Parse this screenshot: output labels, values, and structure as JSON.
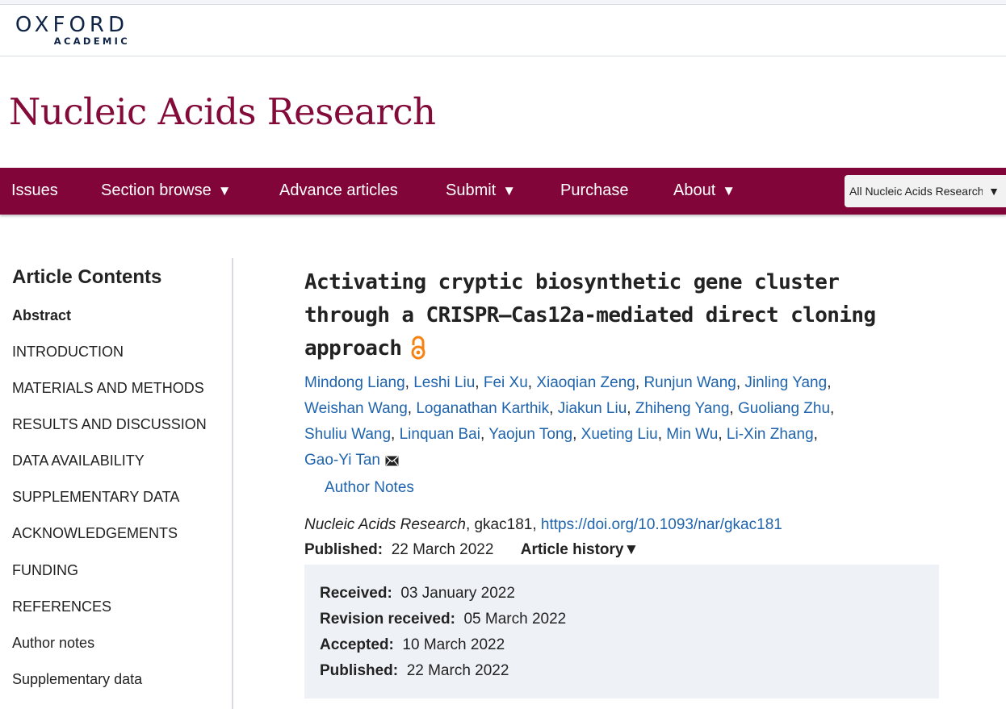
{
  "logo": {
    "line1": "OXFORD",
    "line2": "ACADEMIC"
  },
  "journal": {
    "title": "Nucleic Acids Research"
  },
  "nav": {
    "items": [
      {
        "label": "Issues",
        "dropdown": false
      },
      {
        "label": "Section browse",
        "dropdown": true
      },
      {
        "label": "Advance articles",
        "dropdown": false
      },
      {
        "label": "Submit",
        "dropdown": true
      },
      {
        "label": "Purchase",
        "dropdown": false
      },
      {
        "label": "About",
        "dropdown": true
      }
    ],
    "caret": "▼",
    "search_scope": "All Nucleic Acids Research"
  },
  "sidebar": {
    "heading": "Article Contents",
    "items": [
      {
        "label": "Abstract",
        "active": true
      },
      {
        "label": "INTRODUCTION"
      },
      {
        "label": "MATERIALS AND METHODS"
      },
      {
        "label": "RESULTS AND DISCUSSION"
      },
      {
        "label": "DATA AVAILABILITY"
      },
      {
        "label": "SUPPLEMENTARY DATA"
      },
      {
        "label": "ACKNOWLEDGEMENTS"
      },
      {
        "label": "FUNDING"
      },
      {
        "label": "REFERENCES"
      },
      {
        "label": "Author notes"
      },
      {
        "label": "Supplementary data"
      }
    ]
  },
  "article": {
    "title": "Activating cryptic biosynthetic gene cluster through a CRISPR–Cas12a-mediated direct cloning approach",
    "open_access_icon": "open-access-icon",
    "authors": [
      "Mindong Liang",
      "Leshi Liu",
      "Fei Xu",
      "Xiaoqian Zeng",
      "Runjun Wang",
      "Jinling Yang",
      "Weishan Wang",
      "Loganathan Karthik",
      "Jiakun Liu",
      "Zhiheng Yang",
      "Guoliang Zhu",
      "Shuliu Wang",
      "Linquan Bai",
      "Yaojun Tong",
      "Xueting Liu",
      "Min Wu",
      "Li-Xin Zhang",
      "Gao-Yi Tan"
    ],
    "corresponding_icon": "mail-icon",
    "author_notes_label": "Author Notes",
    "citation": {
      "journal": "Nucleic Acids Research",
      "id": ", gkac181, ",
      "doi": "https://doi.org/10.1093/nar/gkac181"
    },
    "published_label": "Published:",
    "published_date": "22 March 2022",
    "history_toggle": "Article history",
    "history": [
      {
        "label": "Received:",
        "date": "03 January 2022"
      },
      {
        "label": "Revision received:",
        "date": "05 March 2022"
      },
      {
        "label": "Accepted:",
        "date": "10 March 2022"
      },
      {
        "label": "Published:",
        "date": "22 March 2022"
      }
    ]
  },
  "colors": {
    "brand": "#810538",
    "journal_title": "#840a3a",
    "link": "#1f64ad",
    "history_bg": "#eef1f6",
    "open_access": "#f68212",
    "logo": "#0f2444"
  }
}
